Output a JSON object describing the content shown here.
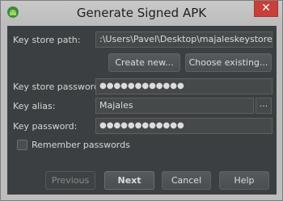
{
  "window": {
    "title": "Generate Signed APK",
    "app_icon": "android-icon",
    "close_icon": "close-icon",
    "close_glyph": "✕"
  },
  "form": {
    "key_store_path_label": "Key store path:",
    "key_store_path_value": ":\\Users\\Pavel\\Desktop\\majaleskeystore.jks",
    "create_new_label": "Create new...",
    "choose_existing_label": "Choose existing...",
    "key_store_password_label": "Key store password:",
    "key_store_password_value": "●●●●●●●●●●●●",
    "key_alias_label": "Key alias:",
    "key_alias_value": "Majales",
    "key_alias_browse_label": "...",
    "key_password_label": "Key password:",
    "key_password_value": "●●●●●●●●●●●●",
    "remember_passwords_label": "Remember passwords",
    "remember_passwords_checked": false
  },
  "footer": {
    "previous_label": "Previous",
    "next_label": "Next",
    "cancel_label": "Cancel",
    "help_label": "Help"
  }
}
